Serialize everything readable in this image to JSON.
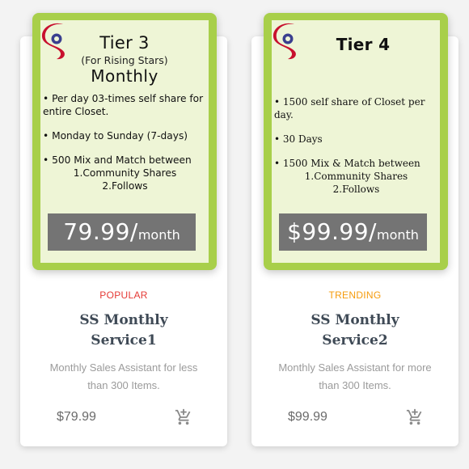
{
  "cards": [
    {
      "banner": {
        "tier": "Tier 3",
        "subtitle": "(For Rising Stars)",
        "period": "Monthly",
        "features": [
          "• Per day 03-times self share for entire Closet.",
          "• Monday to  Sunday (7-days)",
          "• 500 Mix and Match between"
        ],
        "feature_sub": [
          "1.Community Shares",
          "2.Follows"
        ],
        "price_amount": "79.99/",
        "price_period": "month"
      },
      "tag": "POPULAR",
      "name_line1": "SS Monthly",
      "name_line2": "Service1",
      "description": "Monthly Sales Assistant for less than 300 Items.",
      "price": "$79.99",
      "cart_icon": "add-to-cart-icon"
    },
    {
      "banner": {
        "tier": "Tier 4",
        "features": [
          "• 1500 self share of Closet per day.",
          "• 30 Days",
          "• 1500 Mix & Match between"
        ],
        "feature_sub": [
          "1.Community Shares",
          "2.Follows"
        ],
        "price_amount": "$99.99/",
        "price_period": "month"
      },
      "tag": "TRENDING",
      "name_line1": "SS Monthly",
      "name_line2": "Service2",
      "description": "Monthly Sales Assistant for more than 300 Items.",
      "price": "$99.99",
      "cart_icon": "add-to-cart-icon"
    }
  ],
  "colors": {
    "banner_frame": "#a8cf4a",
    "banner_bg": "#eef5d6",
    "price_box": "#747474",
    "popular": "#e53935",
    "trending": "#f59b0b",
    "service_name": "#3f4a56",
    "cart": "#8a8a8a",
    "logo_red": "#c8102e",
    "logo_blue": "#3a3f8f"
  }
}
